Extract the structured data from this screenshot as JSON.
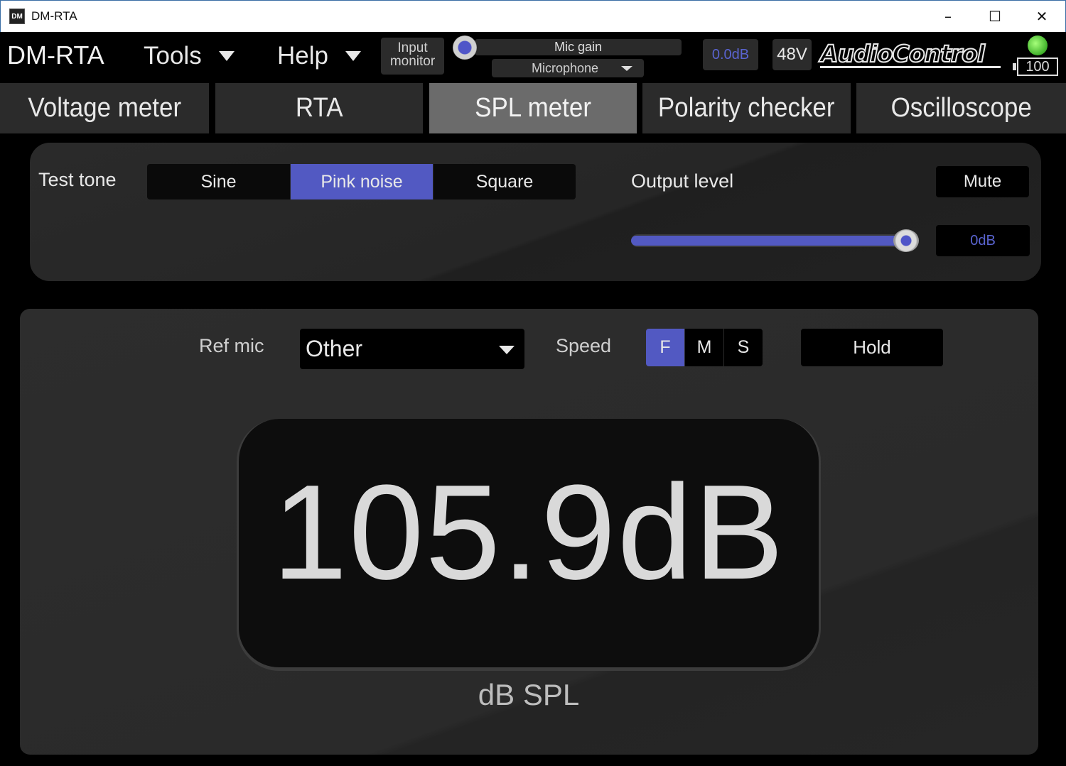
{
  "window": {
    "title": "DM-RTA",
    "icon_text": "DM",
    "minimize": "–",
    "maximize": "☐",
    "close": "✕"
  },
  "toolbar": {
    "brand": "DM-RTA",
    "menu_tools": "Tools",
    "menu_help": "Help",
    "input_monitor_line1": "Input",
    "input_monitor_line2": "monitor",
    "mic_gain_label": "Mic gain",
    "mic_source": "Microphone",
    "level": "0.0dB",
    "phantom": "48V",
    "logo": "AudioControl",
    "battery": "100"
  },
  "tabs": [
    {
      "label": "Voltage meter",
      "active": false
    },
    {
      "label": "RTA",
      "active": false
    },
    {
      "label": "SPL meter",
      "active": true
    },
    {
      "label": "Polarity checker",
      "active": false
    },
    {
      "label": "Oscilloscope",
      "active": false
    }
  ],
  "test_tone": {
    "label": "Test tone",
    "options": [
      "Sine",
      "Pink noise",
      "Square"
    ],
    "selected": "Pink noise",
    "output_level_label": "Output level",
    "mute_label": "Mute",
    "output_level_value": "0dB",
    "slider_fraction": 1.0
  },
  "spl": {
    "ref_mic_label": "Ref mic",
    "ref_mic_value": "Other",
    "speed_label": "Speed",
    "speed_options": [
      "F",
      "M",
      "S"
    ],
    "speed_selected": "F",
    "hold_label": "Hold",
    "reading": "105.9dB",
    "unit": "dB SPL"
  },
  "colors": {
    "accent": "#5259c2",
    "led_green": "#3fb12a",
    "readout_blue": "#5a64d0"
  }
}
